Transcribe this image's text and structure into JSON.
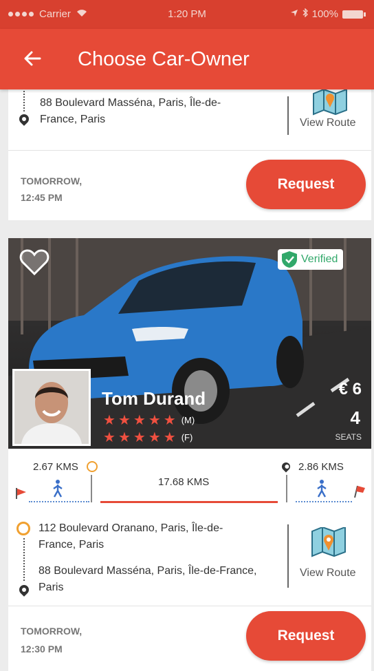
{
  "status_bar": {
    "carrier": "Carrier",
    "time": "1:20 PM",
    "battery": "100%"
  },
  "app_bar": {
    "back_icon": "arrow-left-icon",
    "title": "Choose Car-Owner"
  },
  "rides": [
    {
      "to_address": "88 Boulevard Masséna, Paris, Île-de-France, Paris",
      "view_route_label": "View Route",
      "when": "TOMORROW,",
      "time": "12:45 PM",
      "request_label": "Request"
    },
    {
      "verified_label": "Verified",
      "owner_name": "Tom Durand",
      "rating_male_tag": "(M)",
      "rating_female_tag": "(F)",
      "rating_male_stars": 5,
      "rating_female_stars": 5,
      "price": "€ 6",
      "seats": "4",
      "seats_label": "SEATS",
      "walk_to_pickup": "2.67 KMS",
      "ride_distance": "17.68 KMS",
      "walk_from_drop": "2.86 KMS",
      "from_address": "112 Boulevard Oranano, Paris, Île-de-France, Paris",
      "to_address": "88 Boulevard Masséna, Paris, Île-de-France, Paris",
      "view_route_label": "View Route",
      "when": "TOMORROW,",
      "time": "12:30 PM",
      "request_label": "Request"
    }
  ],
  "colors": {
    "primary": "#e64a37",
    "status_bar": "#d8402f",
    "verified_green": "#31a86a",
    "star_red": "#f05040",
    "pickup_orange": "#f0a030"
  }
}
